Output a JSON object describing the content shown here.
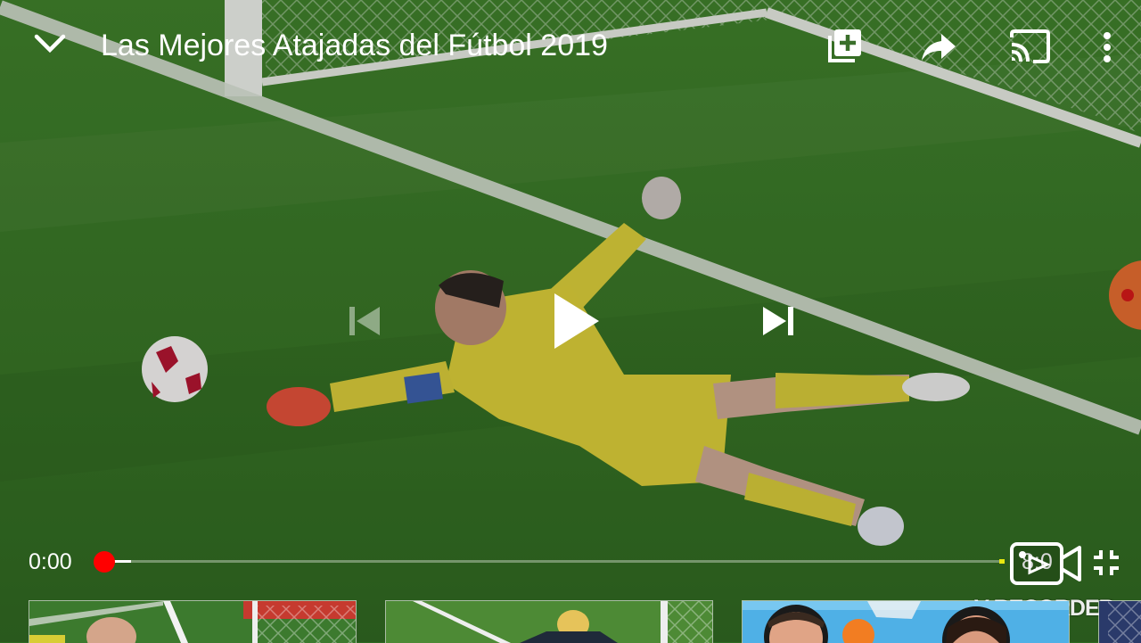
{
  "player": {
    "title": "Las Mejores Atajadas del Fútbol 2019",
    "current_time": "0:00",
    "duration": "8:0",
    "progress": 0.0,
    "accent_color": "#ff0000"
  },
  "top_controls": {
    "collapse_icon": "chevron-down-icon",
    "add_to_playlist_icon": "playlist-add-icon",
    "share_icon": "share-arrow-icon",
    "cast_icon": "cast-icon",
    "more_icon": "more-vertical-icon"
  },
  "center_controls": {
    "previous_icon": "skip-previous-icon",
    "play_icon": "play-icon",
    "next_icon": "skip-next-icon"
  },
  "bottom_controls": {
    "exit_fullscreen_icon": "fullscreen-exit-icon"
  },
  "overlay": {
    "recorder_label": "V-RECORDER",
    "recorder_icon": "video-camera-icon"
  },
  "recommendations": {
    "items": [
      {
        "kind": "goalkeeper-save"
      },
      {
        "kind": "goalkeeper-save"
      },
      {
        "kind": "two-people"
      },
      {
        "kind": "partial"
      }
    ]
  }
}
